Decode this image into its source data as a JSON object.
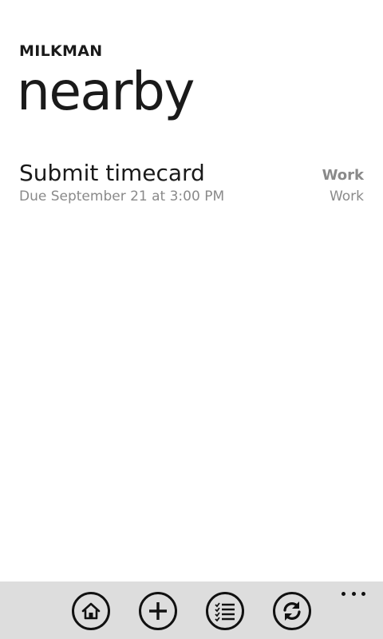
{
  "header": {
    "app_title": "MILKMAN",
    "page_title": "nearby"
  },
  "tasks": [
    {
      "name": "Submit timecard",
      "due": "Due September 21 at 3:00 PM",
      "list": "Work",
      "tag": "Work"
    }
  ],
  "app_bar": {
    "buttons": [
      {
        "icon": "home-icon"
      },
      {
        "icon": "add-icon"
      },
      {
        "icon": "checklist-icon"
      },
      {
        "icon": "sync-icon"
      }
    ],
    "more_icon": "ellipsis-icon",
    "background": "#dddddd"
  },
  "colors": {
    "text_primary": "#1a1a1a",
    "text_secondary": "#8a8a8a",
    "background": "#ffffff"
  }
}
